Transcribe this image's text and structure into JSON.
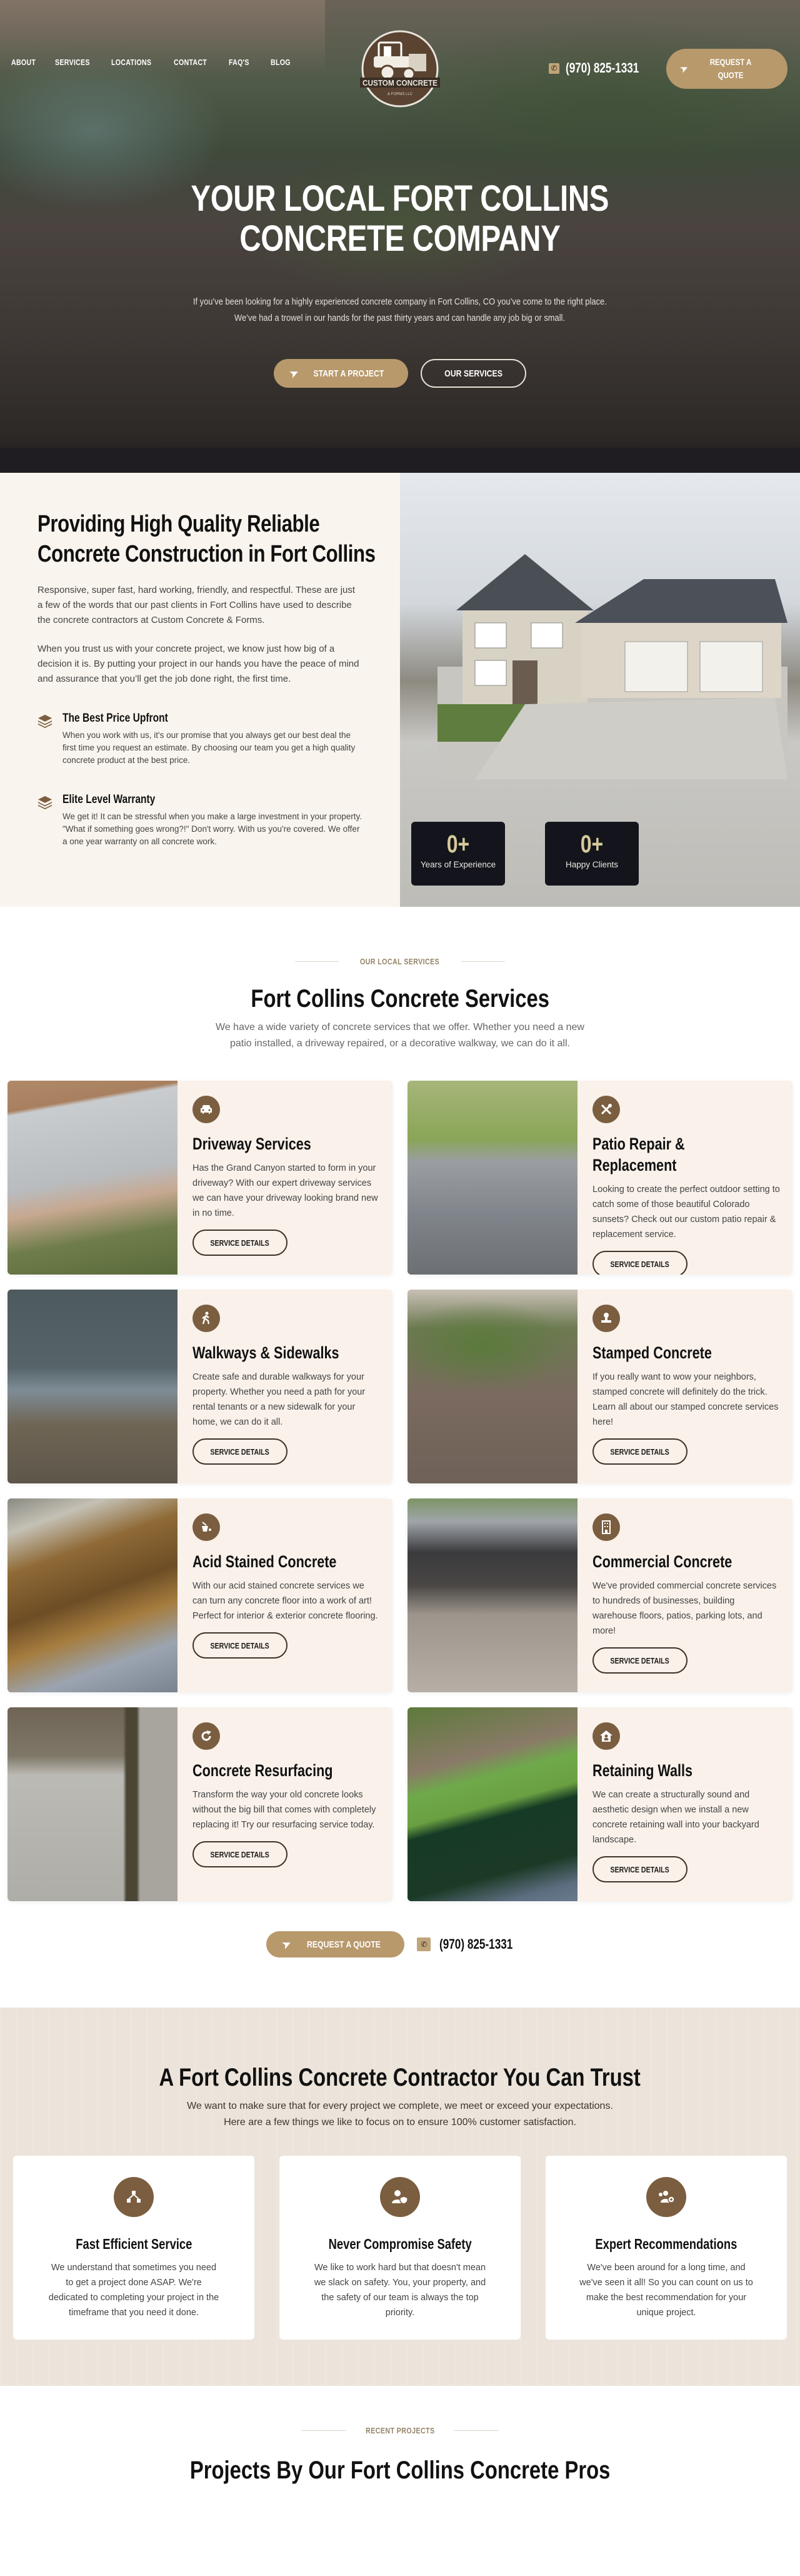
{
  "nav": {
    "items": [
      "ABOUT",
      "SERVICES",
      "LOCATIONS",
      "CONTACT",
      "FAQ'S",
      "BLOG"
    ],
    "logo": {
      "name": "CUSTOM CONCRETE",
      "tagline": "& FORMS LLC"
    },
    "phone": "(970) 825-1331",
    "quote_button": "REQUEST A QUOTE",
    "phone_icon": "phone-icon",
    "quote_icon": "paper-plane-icon"
  },
  "hero": {
    "title_line1": "YOUR LOCAL FORT COLLINS",
    "title_line2": "CONCRETE COMPANY",
    "subtitle_line1": "If you’ve been looking for a highly experienced concrete company in Fort Collins, CO you’ve come to the right place.",
    "subtitle_line2": "We’ve had a trowel in our hands for the past thirty years and can handle any job big or small.",
    "primary_button": "START A PROJECT",
    "secondary_button": "OUR SERVICES"
  },
  "about": {
    "title_line1": "Providing High Quality Reliable",
    "title_line2": "Concrete Construction in Fort Collins",
    "paragraph1": "Responsive, super fast, hard working, friendly, and respectful. These are just a few of the words that our past clients in Fort Collins have used to describe the concrete contractors at Custom Concrete & Forms.",
    "paragraph2": "When you trust us with your concrete project, we know just how big of a decision it is. By putting your project in our hands you have the peace of mind and assurance that you’ll get the job done right, the first time.",
    "features": [
      {
        "icon": "layers-icon",
        "title": "The Best Price Upfront",
        "text": "When you work with us, it's our promise that you always get our best deal the first time you request an estimate. By choosing our team you get a high quality concrete product at the best price."
      },
      {
        "icon": "layers-icon",
        "title": "Elite Level Warranty",
        "text": "We get it! It can be stressful when you make a large investment in your property. \"What if something goes wrong?!\" Don't worry. With us you're covered. We offer a one year warranty on all concrete work."
      }
    ],
    "stats": [
      {
        "value": "0+",
        "label": "Years of Experience"
      },
      {
        "value": "0+",
        "label": "Happy Clients"
      }
    ]
  },
  "services": {
    "eyebrow": "OUR LOCAL SERVICES",
    "title": "Fort Collins Concrete Services",
    "subtitle": "We have a wide variety of concrete services that we offer. Whether you need a new patio installed, a driveway repaired, or a decorative walkway, we can do it all.",
    "button_label": "SERVICE DETAILS",
    "items": [
      {
        "icon": "car-icon",
        "title": "Driveway Services",
        "text": "Has the Grand Canyon started to form in your driveway? With our expert driveway services we can have your driveway looking brand new in no time."
      },
      {
        "icon": "tools-icon",
        "title": "Patio Repair & Replacement",
        "text": "Looking to create the perfect outdoor setting to catch some of those beautiful Colorado sunsets? Check out our custom patio repair & replacement service."
      },
      {
        "icon": "walking-person-icon",
        "title": "Walkways & Sidewalks",
        "text": "Create safe and durable walkways for your property. Whether you need a path for your rental tenants or a new sidewalk for your home, we can do it all."
      },
      {
        "icon": "stamp-icon",
        "title": "Stamped Concrete",
        "text": "If you really want to wow your neighbors, stamped concrete will definitely do the trick. Learn all about our stamped concrete services here!"
      },
      {
        "icon": "paint-bucket-icon",
        "title": "Acid Stained Concrete",
        "text": "With our acid stained concrete services we can turn any concrete floor into a work of art! Perfect for interior & exterior concrete flooring."
      },
      {
        "icon": "building-icon",
        "title": "Commercial Concrete",
        "text": "We've provided commercial concrete services to hundreds of businesses, building warehouse floors, patios, parking lots, and more!"
      },
      {
        "icon": "redo-icon",
        "title": "Concrete Resurfacing",
        "text": "Transform the way your old concrete looks without the big bill that comes with completely replacing it! Try our resurfacing service today."
      },
      {
        "icon": "house-user-icon",
        "title": "Retaining Walls",
        "text": "We can create a structurally sound and aesthetic design when we install a new concrete retaining wall into your backyard landscape."
      }
    ],
    "cta_button": "REQUEST A QUOTE",
    "cta_phone": "(970) 825-1331"
  },
  "trust": {
    "title": "A Fort Collins Concrete Contractor You Can Trust",
    "subtitle": "We want to make sure that for every project we complete, we meet or exceed your expectations. Here are a few things we like to focus on to ensure 100% customer satisfaction.",
    "items": [
      {
        "icon": "project-diagram-icon",
        "title": "Fast Efficient Service",
        "text": "We understand that sometimes you need to get a project done ASAP. We're dedicated to completing your project in the timeframe that you need it done."
      },
      {
        "icon": "user-shield-icon",
        "title": "Never Compromise Safety",
        "text": "We like to work hard but that doesn't mean we slack on safety. You, your property, and the safety of our team is always the top priority."
      },
      {
        "icon": "users-cog-icon",
        "title": "Expert Recommendations",
        "text": "We've been around for a long time, and we've seen it all! So you can count on us to make the best recommendation for your unique project."
      }
    ]
  },
  "recent": {
    "eyebrow": "RECENT PROJECTS",
    "title": "Projects By Our Fort Collins Concrete Pros"
  },
  "colors": {
    "accent_tan": "#b8996c",
    "icon_brown": "#7b5e40",
    "cream_bg": "#f9f4ed",
    "trust_bg": "#ece4da",
    "stat_bg": "#14151c"
  }
}
